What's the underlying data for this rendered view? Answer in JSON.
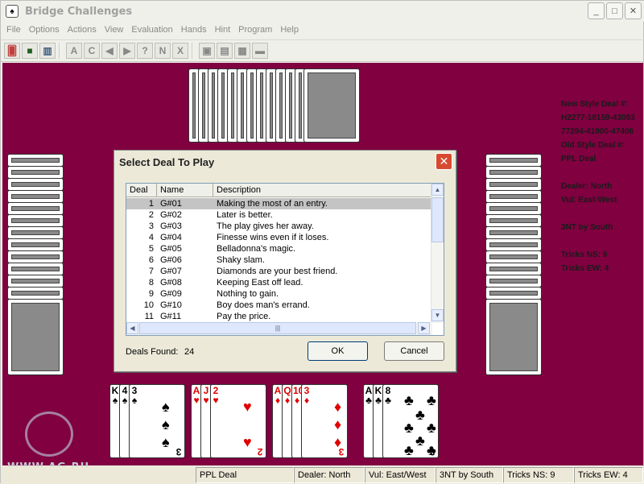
{
  "window": {
    "title": "Bridge Challenges",
    "icon_glyph": "♠",
    "buttons": {
      "minimize": "_",
      "maximize": "□",
      "close": "✕"
    }
  },
  "menu": [
    "File",
    "Options",
    "Actions",
    "View",
    "Evaluation",
    "Hands",
    "Hint",
    "Program",
    "Help"
  ],
  "toolbar": {
    "group1": [
      "🂠",
      "■",
      "▥"
    ],
    "group2": [
      "A",
      "C",
      "◀",
      "▶",
      "?",
      "N",
      "X"
    ],
    "group3": [
      "▣",
      "▤",
      "▦",
      "▬"
    ]
  },
  "info": {
    "new_style_label": "New Style Deal #:",
    "new_style_line1": "H2277-18159-43093",
    "new_style_line2": "77294-41900-47406",
    "old_style_label": "Old Style Deal #:",
    "old_style_value": "PPL Deal",
    "dealer": "Dealer: North",
    "vul": "Vul: East-West",
    "contract": "3NT by South",
    "tricks_ns": "Tricks NS: 9",
    "tricks_ew": "Tricks EW: 4"
  },
  "south_hand": [
    {
      "name": "spades",
      "color": "black",
      "symbol": "♠",
      "ranks": [
        "K",
        "4",
        "3"
      ]
    },
    {
      "name": "hearts",
      "color": "red",
      "symbol": "♥",
      "ranks": [
        "A",
        "J",
        "2"
      ]
    },
    {
      "name": "diamonds",
      "color": "red",
      "symbol": "♦",
      "ranks": [
        "A",
        "Q",
        "10",
        "3"
      ]
    },
    {
      "name": "clubs",
      "color": "black",
      "symbol": "♣",
      "ranks": [
        "A",
        "K",
        "8"
      ]
    }
  ],
  "logo_text": "WWW.AG.RU",
  "status": {
    "deal": "PPL Deal",
    "dealer": "Dealer: North",
    "vul": "Vul: East/West",
    "contract": "3NT by South",
    "tricks_ns": "Tricks NS: 9",
    "tricks_ew": "Tricks EW: 4"
  },
  "dialog": {
    "title": "Select Deal To Play",
    "close": "✕",
    "columns": [
      "Deal",
      "Name",
      "Description"
    ],
    "rows": [
      [
        "1",
        "G#01",
        "Making the most of an entry."
      ],
      [
        "2",
        "G#02",
        "Later is better."
      ],
      [
        "3",
        "G#03",
        "The play gives her away."
      ],
      [
        "4",
        "G#04",
        "Finesse wins even if it loses."
      ],
      [
        "5",
        "G#05",
        "Belladonna's magic."
      ],
      [
        "6",
        "G#06",
        "Shaky slam."
      ],
      [
        "7",
        "G#07",
        "Diamonds are your best friend."
      ],
      [
        "8",
        "G#08",
        "Keeping East off lead."
      ],
      [
        "9",
        "G#09",
        "Nothing to gain."
      ],
      [
        "10",
        "G#10",
        "Boy does man's errand."
      ],
      [
        "11",
        "G#11",
        "Pay the price."
      ]
    ],
    "selected_row": 1,
    "deals_found_label": "Deals Found:",
    "deals_found_value": "24",
    "ok_label": "OK",
    "cancel_label": "Cancel",
    "scroll": {
      "up": "▲",
      "down": "▼",
      "left": "◀",
      "right": "▶",
      "grip": "|||"
    }
  }
}
